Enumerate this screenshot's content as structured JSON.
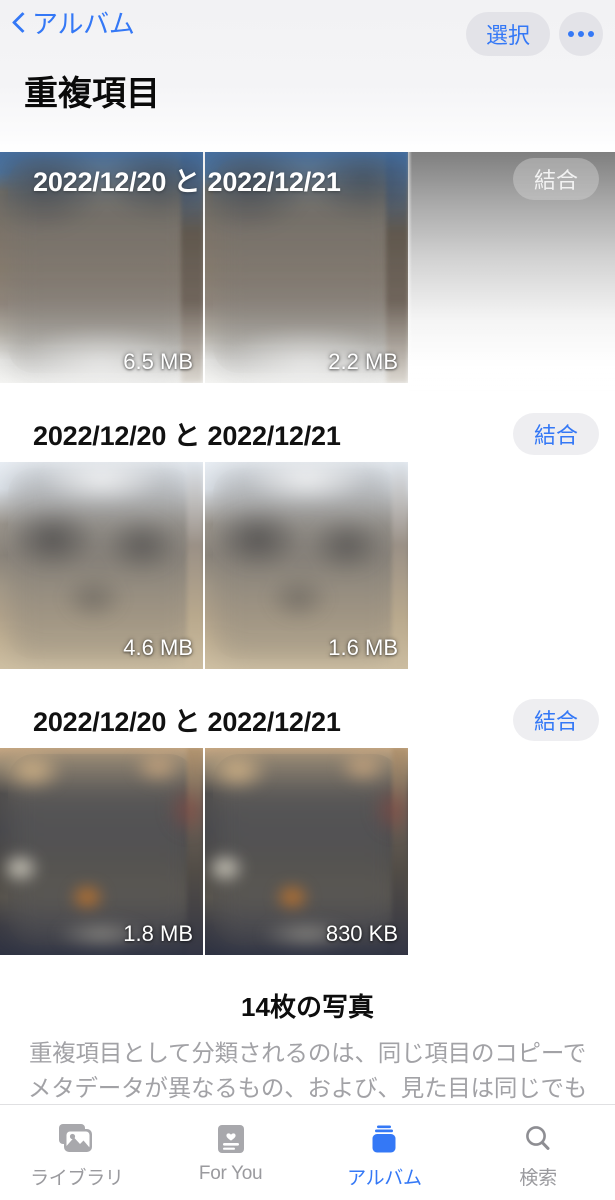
{
  "nav": {
    "back_label": "アルバム",
    "back_icon": "chevron-left-icon",
    "select_label": "選択",
    "more_icon": "ellipsis-icon",
    "title": "重複項目"
  },
  "groups": [
    {
      "title": "2022/12/20 と 2022/12/21",
      "merge_label": "結合",
      "photos": [
        {
          "size": "6.5 MB"
        },
        {
          "size": "2.2 MB"
        }
      ]
    },
    {
      "title": "2022/12/20 と 2022/12/21",
      "merge_label": "結合",
      "photos": [
        {
          "size": "4.6 MB"
        },
        {
          "size": "1.6 MB"
        }
      ]
    },
    {
      "title": "2022/12/20 と 2022/12/21",
      "merge_label": "結合",
      "photos": [
        {
          "size": "1.8 MB"
        },
        {
          "size": "830 KB"
        }
      ]
    }
  ],
  "footer": {
    "count": "14枚の写真",
    "description": "重複項目として分類されるのは、同じ項目のコピーでメタデータが異なるもの、および、見た目は同じでも解像度、ファイルフォーマット、またはその他の微妙な点で異なるものの両方です。"
  },
  "tabbar": {
    "items": [
      {
        "label": "ライブラリ",
        "icon": "photo-stack-icon",
        "active": false
      },
      {
        "label": "For You",
        "icon": "for-you-card-icon",
        "active": false
      },
      {
        "label": "アルバム",
        "icon": "albums-stack-icon",
        "active": true
      },
      {
        "label": "検索",
        "icon": "search-icon",
        "active": false
      }
    ]
  },
  "colors": {
    "accent": "#3478f6",
    "inactive": "#9a9a9e",
    "pill_bg": "#e3e3e8",
    "muted_text": "#a2a2a6"
  }
}
